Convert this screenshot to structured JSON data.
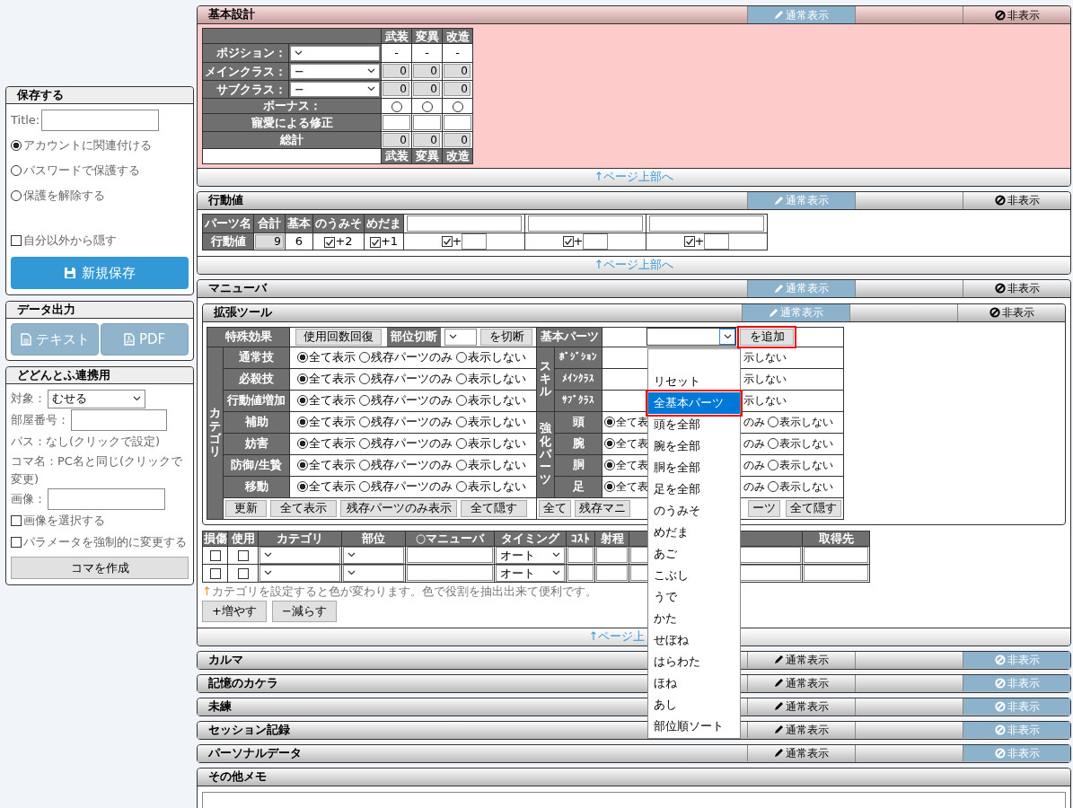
{
  "sidebar": {
    "save": {
      "title": "保存する",
      "title_label": "Title:",
      "protect_options": [
        {
          "label": "アカウントに関連付ける",
          "selected": true
        },
        {
          "label": "パスワードで保護する",
          "selected": false
        },
        {
          "label": "保護を解除する",
          "selected": false
        }
      ],
      "hide_option": {
        "label": "自分以外から隠す",
        "checked": false
      },
      "save_button": "新規保存"
    },
    "export": {
      "title": "データ出力",
      "buttons": [
        {
          "kind": "text",
          "label": "テキスト"
        },
        {
          "kind": "pdf",
          "label": "PDF"
        }
      ]
    },
    "dodontof": {
      "title": "どどんとふ連携用",
      "target_label": "対象：",
      "target_value": "むせる",
      "room_label": "部屋番号：",
      "path_text": "パス：なし(クリックで設定)",
      "koma_text": "コマ名：PC名と同じ(クリックで変更)",
      "image_label": "画像：",
      "options": [
        {
          "label": "画像を選択する",
          "checked": false
        },
        {
          "label": "パラメータを強制的に変更する",
          "checked": false
        }
      ],
      "create_button": "コマを作成"
    }
  },
  "sections": [
    {
      "kind": "design",
      "title": "基本設計",
      "view_buttons": [
        {
          "label": "通常表示",
          "selected": true
        },
        {
          "label": "非表示",
          "selected": false
        }
      ],
      "columns": [
        "武装",
        "変異",
        "改造"
      ],
      "rows": [
        {
          "kind": "select",
          "label": "ポジション：",
          "cells": [
            "-",
            "-",
            "-"
          ]
        },
        {
          "kind": "select",
          "label": "メインクラス：",
          "choice": "−",
          "fields": [
            "0",
            "0",
            "0"
          ]
        },
        {
          "kind": "select",
          "label": "サブクラス：",
          "choice": "−",
          "fields": [
            "0",
            "0",
            "0"
          ]
        },
        {
          "kind": "radio",
          "label": "ボーナス：",
          "options": [
            {
              "selected": false
            },
            {
              "selected": false
            },
            {
              "selected": false
            }
          ]
        },
        {
          "kind": "input",
          "label": "寵愛による修正"
        },
        {
          "kind": "total",
          "label": "総計",
          "fields": [
            "0",
            "0",
            "0"
          ]
        }
      ],
      "footer_columns": [
        "武装",
        "変異",
        "改造"
      ],
      "page_top": "↑ページ上部へ"
    },
    {
      "kind": "action",
      "title": "行動値",
      "view_buttons": [
        {
          "label": "通常表示",
          "selected": true
        },
        {
          "label": "非表示",
          "selected": false
        }
      ],
      "header": [
        "パーツ名",
        "合計",
        "基本",
        "のうみそ",
        "めだま"
      ],
      "row_label": "行動値",
      "total": "9",
      "base": "6",
      "bonuses": [
        {
          "checked": true,
          "value": "+2"
        },
        {
          "checked": true,
          "value": "+1"
        }
      ],
      "custom_parts": [
        {
          "checked": true,
          "sign": "+"
        },
        {
          "checked": true,
          "sign": "+"
        },
        {
          "checked": true,
          "sign": "+"
        }
      ],
      "page_top": "↑ページ上部へ"
    },
    {
      "kind": "maneuver",
      "title": "マニューバ",
      "view_buttons": [
        {
          "label": "通常表示",
          "selected": true
        },
        {
          "label": "非表示",
          "selected": false
        }
      ],
      "tool": {
        "title": "拡張ツール",
        "view_buttons": [
          {
            "label": "通常表示",
            "selected": true
          },
          {
            "label": "非表示",
            "selected": false
          }
        ],
        "special_label": "特殊効果",
        "restore_button": "使用回数回復",
        "cut_label": "部位切断",
        "cut_button": "を切断",
        "basic_label": "基本パーツ",
        "add_button": "を追加",
        "category_label": "カテゴリ",
        "categories": [
          {
            "label": "通常技",
            "options": [
              {
                "label": "全て表示",
                "selected": true
              },
              {
                "label": "残存パーツのみ",
                "selected": false
              },
              {
                "label": "表示しない",
                "selected": false
              }
            ]
          },
          {
            "label": "必殺技",
            "options": [
              {
                "label": "全て表示",
                "selected": true
              },
              {
                "label": "残存パーツのみ",
                "selected": false
              },
              {
                "label": "表示しない",
                "selected": false
              }
            ]
          },
          {
            "label": "行動値増加",
            "options": [
              {
                "label": "全て表示",
                "selected": true
              },
              {
                "label": "残存パーツのみ",
                "selected": false
              },
              {
                "label": "表示しない",
                "selected": false
              }
            ]
          },
          {
            "label": "補助",
            "options": [
              {
                "label": "全て表示",
                "selected": true
              },
              {
                "label": "残存パーツのみ",
                "selected": false
              },
              {
                "label": "表示しない",
                "selected": false
              }
            ]
          },
          {
            "label": "妨害",
            "options": [
              {
                "label": "全て表示",
                "selected": true
              },
              {
                "label": "残存パーツのみ",
                "selected": false
              },
              {
                "label": "表示しない",
                "selected": false
              }
            ]
          },
          {
            "label": "防御/生贄",
            "options": [
              {
                "label": "全て表示",
                "selected": true
              },
              {
                "label": "残存パーツのみ",
                "selected": false
              },
              {
                "label": "表示しない",
                "selected": false
              }
            ]
          },
          {
            "label": "移動",
            "options": [
              {
                "label": "全て表示",
                "selected": true
              },
              {
                "label": "残存パーツのみ",
                "selected": false
              },
              {
                "label": "表示しない",
                "selected": false
              }
            ]
          }
        ],
        "right_groups": [
          {
            "label": "スキル",
            "rows": [
              {
                "label": "ﾎﾟｼﾞｼｮﾝ",
                "text": "示しない"
              },
              {
                "label": "ﾒｲﾝｸﾗｽ",
                "text": "示しない"
              },
              {
                "label": "ｻﾌﾞｸﾗｽ",
                "text": "示しない"
              }
            ]
          },
          {
            "label": "強化パーツ",
            "rows": [
              {
                "label": "頭",
                "option_left": {
                  "label": "全て表",
                  "selected": true
                },
                "text": "のみ",
                "option_right": {
                  "label": "表示しない",
                  "selected": false
                }
              },
              {
                "label": "腕",
                "option_left": {
                  "label": "全て表",
                  "selected": true
                },
                "text": "のみ",
                "option_right": {
                  "label": "表示しない",
                  "selected": false
                }
              },
              {
                "label": "胴",
                "option_left": {
                  "label": "全て表",
                  "selected": true
                },
                "text": "のみ",
                "option_right": {
                  "label": "表示しない",
                  "selected": false
                }
              },
              {
                "label": "足",
                "option_left": {
                  "label": "全て表",
                  "selected": true
                },
                "text": "のみ",
                "option_right": {
                  "label": "表示しない",
                  "selected": false
                }
              }
            ]
          }
        ],
        "left_buttons": [
          "更新",
          "全て表示",
          "残存パーツのみ表示",
          "全て隠す"
        ],
        "right_buttons_before": [
          "全て",
          "残存マニ"
        ],
        "right_buttons_after": [
          "ーツ",
          "全て隠す"
        ],
        "dropdown": [
          {
            "selected": false
          },
          {
            "label": "リセット",
            "selected": false
          },
          {
            "label": "全基本パーツ",
            "selected": true
          },
          {
            "label": "頭を全部",
            "selected": false
          },
          {
            "label": "腕を全部",
            "selected": false
          },
          {
            "label": "胴を全部",
            "selected": false
          },
          {
            "label": "足を全部",
            "selected": false
          },
          {
            "label": "のうみそ",
            "selected": false
          },
          {
            "label": "めだま",
            "selected": false
          },
          {
            "label": "あご",
            "selected": false
          },
          {
            "label": "こぶし",
            "selected": false
          },
          {
            "label": "うで",
            "selected": false
          },
          {
            "label": "かた",
            "selected": false
          },
          {
            "label": "せぼね",
            "selected": false
          },
          {
            "label": "はらわた",
            "selected": false
          },
          {
            "label": "ほね",
            "selected": false
          },
          {
            "label": "あし",
            "selected": false
          },
          {
            "label": "部位順ソート",
            "selected": false
          }
        ]
      },
      "list": {
        "columns": [
          "損傷",
          "使用",
          "カテゴリ",
          "部位",
          "○マニューバ",
          "タイミング",
          "ｺｽﾄ",
          "射程",
          "取得先"
        ],
        "rows": [
          {
            "damaged": false,
            "used": false,
            "timing": "オート"
          },
          {
            "damaged": false,
            "used": false,
            "timing": "オート"
          }
        ]
      },
      "note_arrow": "↑",
      "note": "カテゴリを設定すると色が変わります。色で役割を抽出出来て便利です。",
      "add_button": "+増やす",
      "remove_button": "−減らす",
      "page_top": "↑ページ上"
    },
    {
      "kind": "collapsed",
      "title": "カルマ",
      "view_buttons": [
        {
          "label": "通常表示",
          "selected": false
        },
        {
          "label": "非表示",
          "selected": true
        }
      ]
    },
    {
      "kind": "collapsed",
      "title": "記憶のカケラ",
      "view_buttons": [
        {
          "label": "通常表示",
          "selected": false
        },
        {
          "label": "非表示",
          "selected": true
        }
      ]
    },
    {
      "kind": "collapsed",
      "title": "未練",
      "view_buttons": [
        {
          "label": "通常表示",
          "selected": false
        },
        {
          "label": "非表示",
          "selected": true
        }
      ]
    },
    {
      "kind": "collapsed",
      "title": "セッション記録",
      "view_buttons": [
        {
          "label": "通常表示",
          "selected": false
        },
        {
          "label": "非表示",
          "selected": true
        }
      ]
    },
    {
      "kind": "collapsed",
      "title": "パーソナルデータ",
      "view_buttons": [
        {
          "label": "通常表示",
          "selected": false
        },
        {
          "label": "非表示",
          "selected": true
        }
      ]
    },
    {
      "kind": "memo",
      "title": "その他メモ"
    }
  ]
}
